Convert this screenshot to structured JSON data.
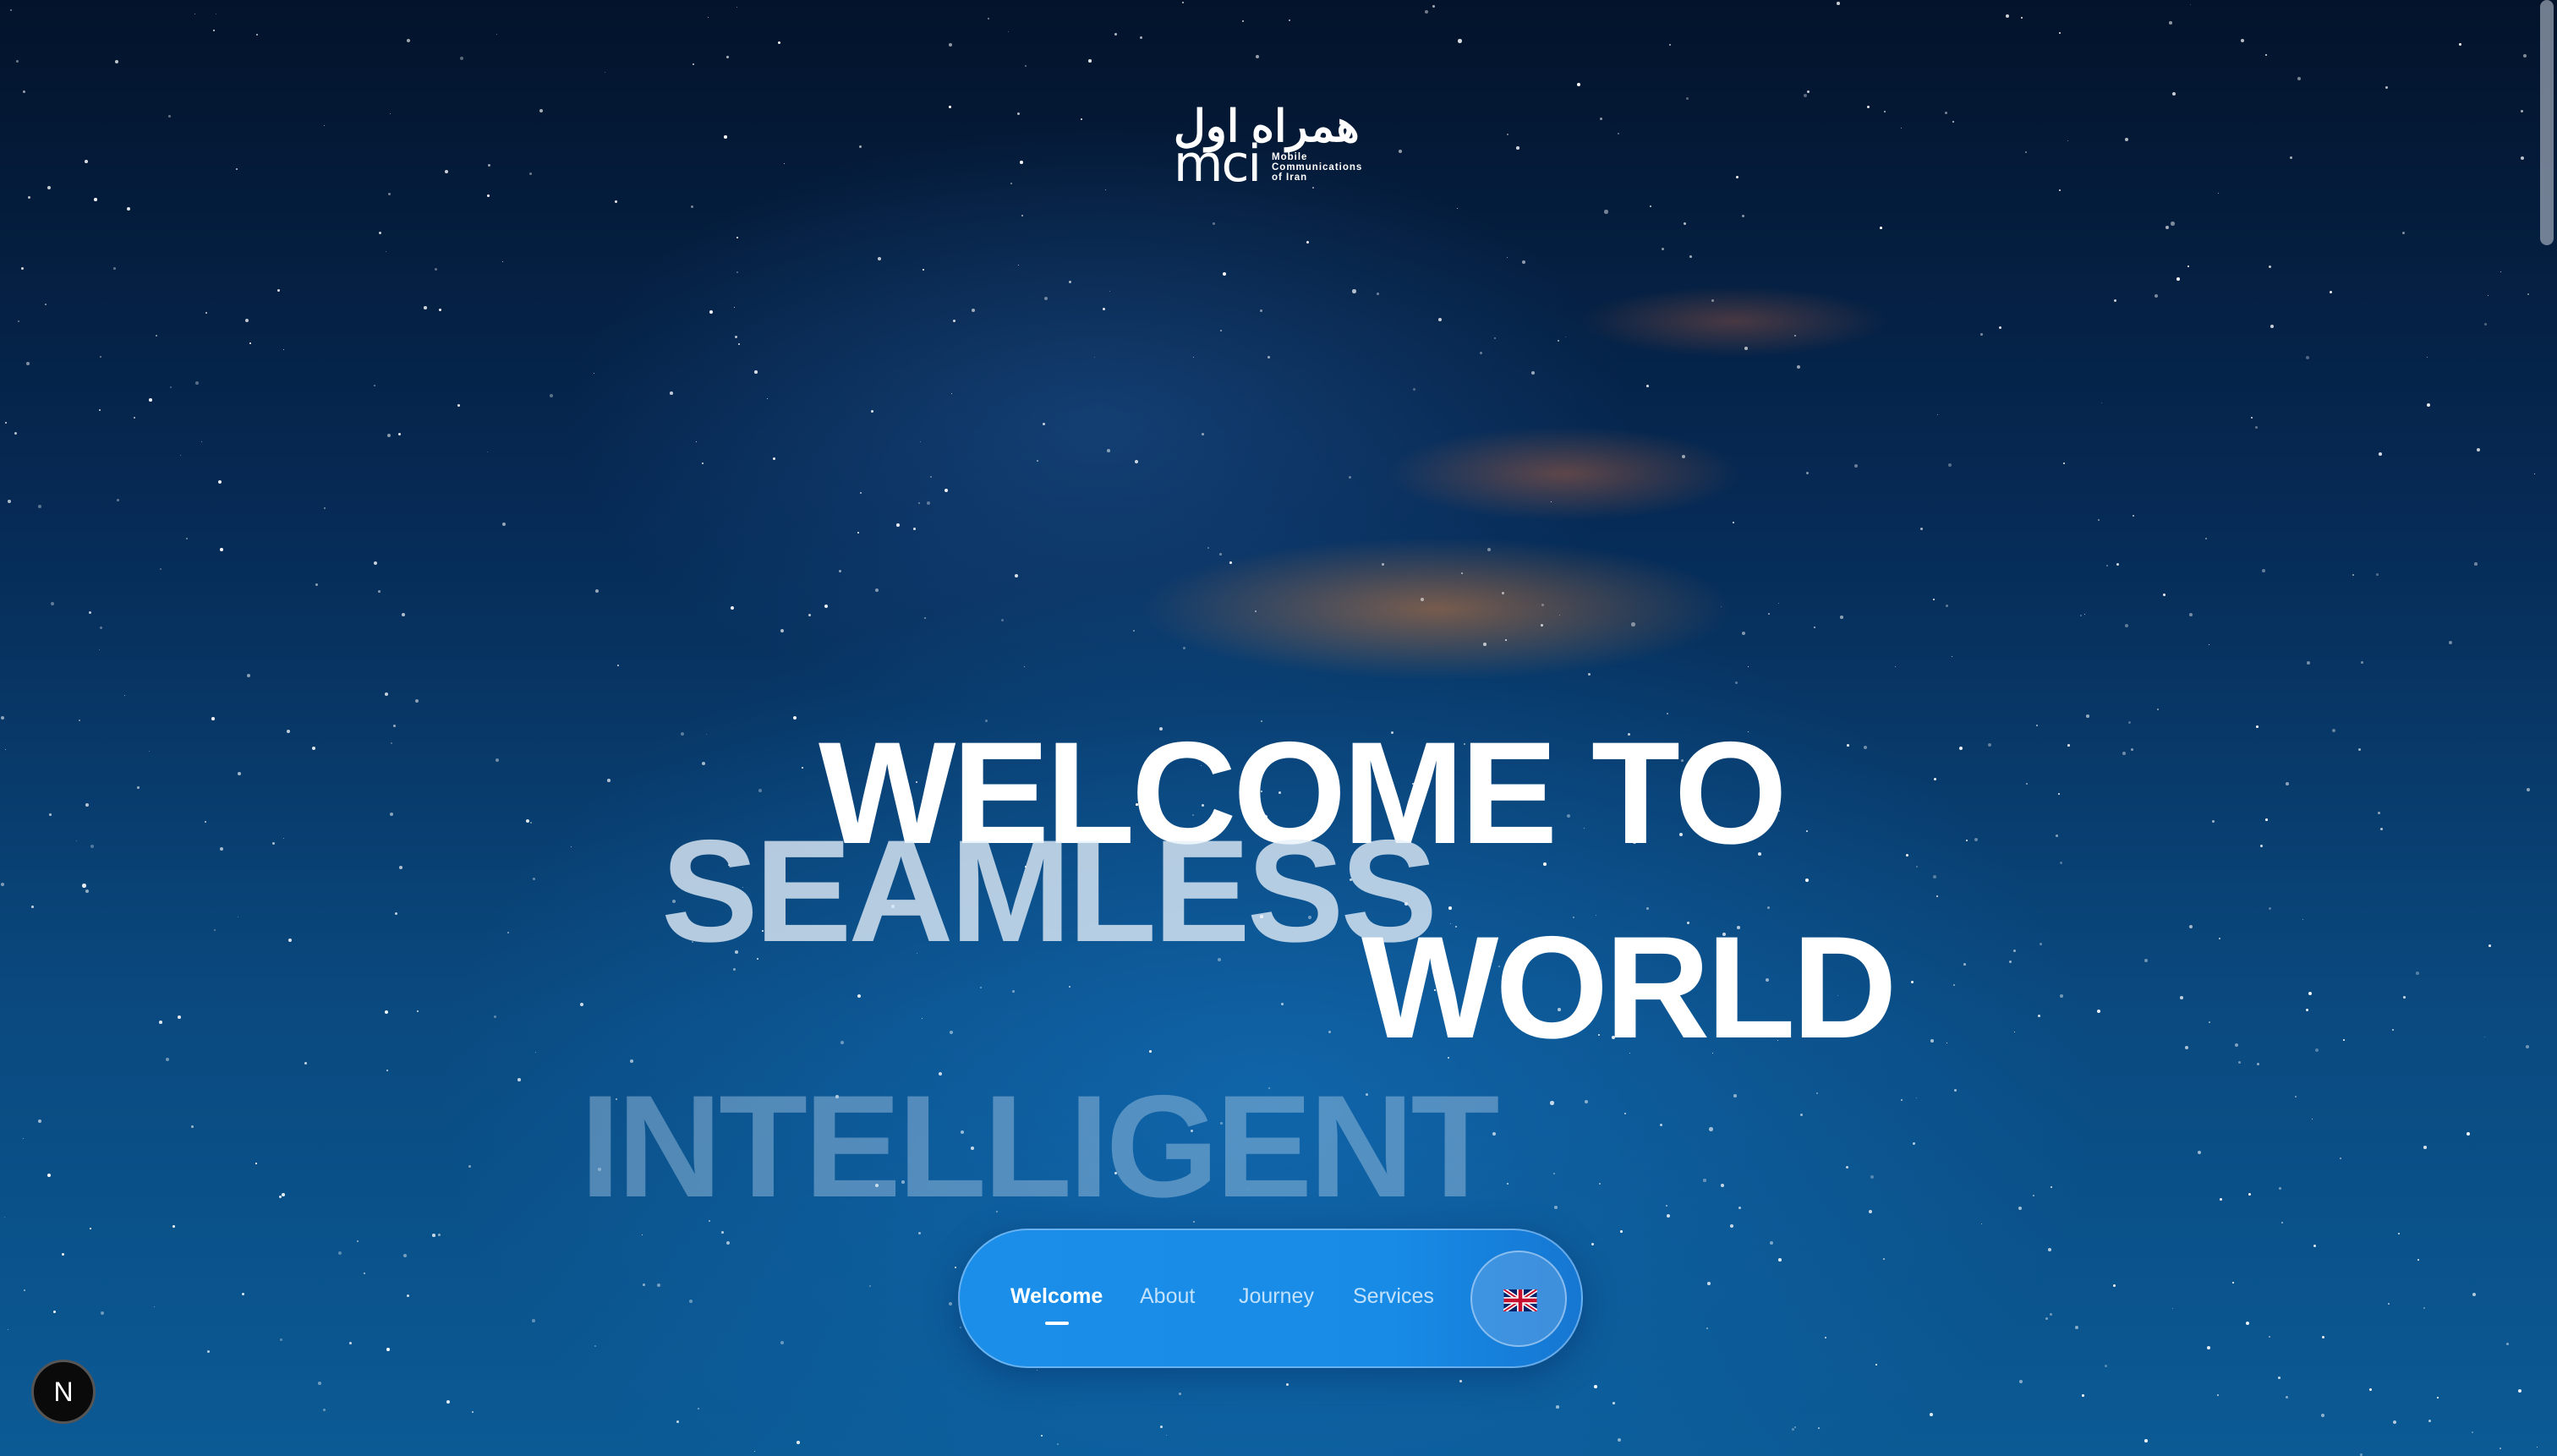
{
  "logo": {
    "arabic": "همراه اول",
    "latin": "mci",
    "sub_lines": [
      "Mobile",
      "Communications",
      "of Iran"
    ]
  },
  "hero": {
    "line1": "WELCOME TO",
    "line2": "SEAMLESS",
    "line3": "WORLD",
    "line4": "INTELLIGENT"
  },
  "nav": {
    "items": [
      {
        "label": "Welcome",
        "active": true
      },
      {
        "label": "About"
      },
      {
        "label": "Journey"
      },
      {
        "label": "Services"
      }
    ],
    "language_icon": "uk-flag-icon"
  },
  "dev_badge": {
    "label": "N"
  }
}
